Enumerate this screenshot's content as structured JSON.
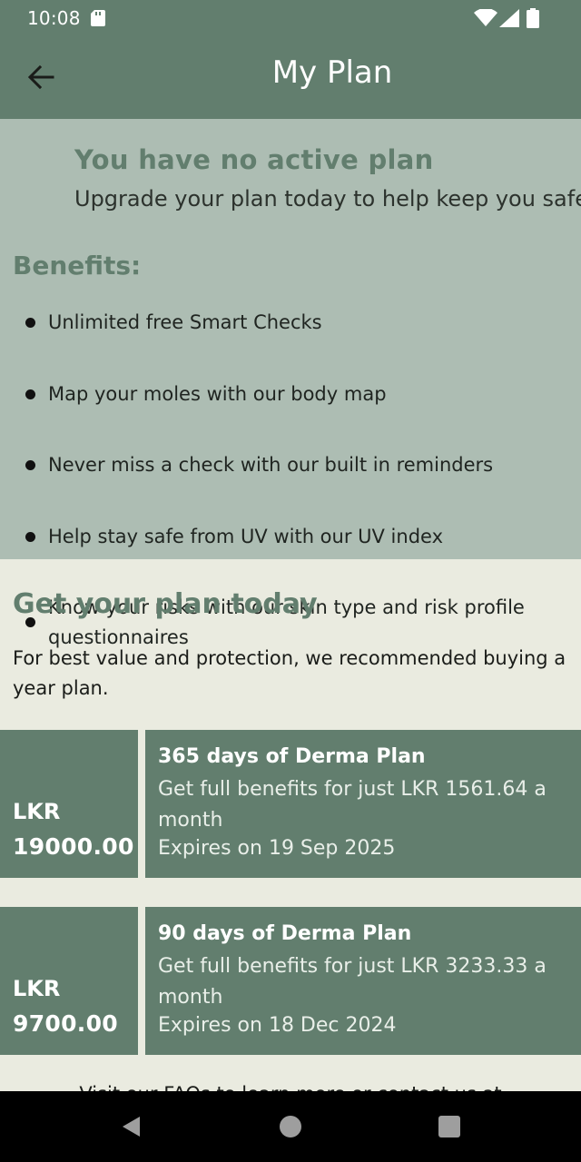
{
  "status_bar": {
    "time": "10:08",
    "icons": [
      "sd-card-icon",
      "wifi-icon",
      "cell-signal-icon",
      "battery-icon"
    ]
  },
  "app_bar": {
    "title": "My Plan",
    "back_icon": "arrow-left-icon"
  },
  "no_plan": {
    "heading": "You have no active plan",
    "subtitle": "Upgrade your plan today to help keep you safe!",
    "benefits_title": "Benefits:",
    "benefits": [
      "Unlimited free Smart Checks",
      "Map your moles with our body map",
      "Never miss a check with our built in reminders",
      "Help stay safe from UV with our UV index",
      "Know your risks with our skin type and risk profile questionnaires"
    ]
  },
  "get_plan": {
    "title": "Get your plan today",
    "description": "For best value and protection, we recommended buying a year plan."
  },
  "plans": [
    {
      "currency": "LKR",
      "amount": "19000.00",
      "name": "365 days of Derma Plan",
      "description": "Get full benefits for just LKR 1561.64 a month",
      "expires": "Expires on 19 Sep 2025"
    },
    {
      "currency": "LKR",
      "amount": "9700.00",
      "name": "90 days of Derma Plan",
      "description": "Get full benefits for just LKR 3233.33 a month",
      "expires": "Expires on 18 Dec 2024"
    }
  ],
  "footer": {
    "faq_text": "Visit our FAQs to learn more or contact us at"
  },
  "colors": {
    "primary": "#627e6e",
    "banner_bg": "#adbdb3",
    "page_bg": "#eaebe0"
  }
}
